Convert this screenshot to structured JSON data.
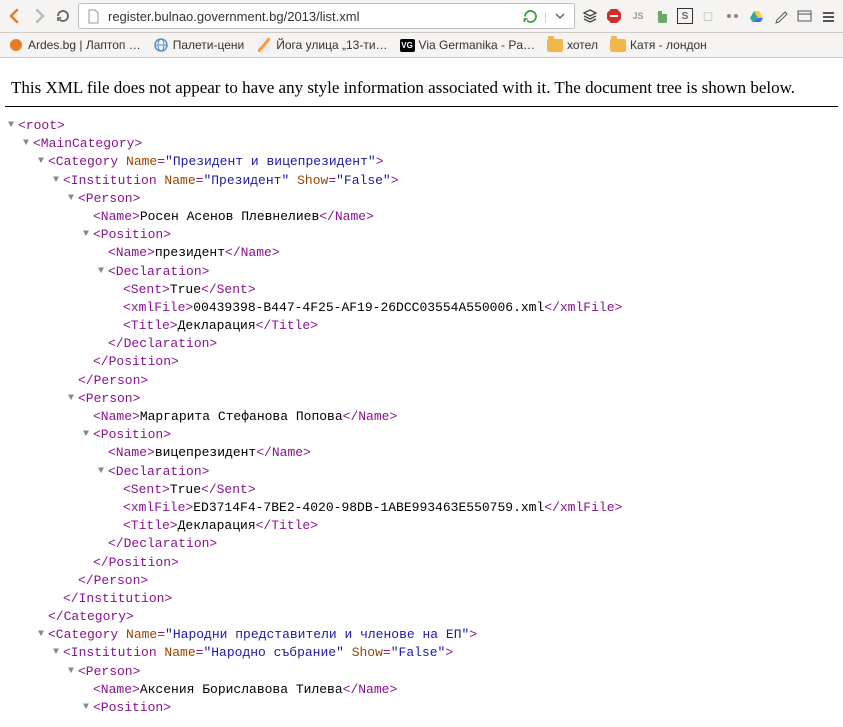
{
  "url": "register.bulnao.government.bg/2013/list.xml",
  "message": "This XML file does not appear to have any style information associated with it. The document tree is shown below.",
  "bookmarks": [
    {
      "label": "Ardes.bg | Лаптоп …",
      "icon": "ardes"
    },
    {
      "label": "Палети-цени",
      "icon": "globe"
    },
    {
      "label": "Йога улица „13-ти…",
      "icon": "gmaps"
    },
    {
      "label": "Via Germanika - Pa…",
      "icon": "vg"
    },
    {
      "label": "хотел",
      "icon": "folder"
    },
    {
      "label": "Катя - лондон",
      "icon": "folder"
    }
  ],
  "s": {
    "root_o": "<root>",
    "maincat_o": "<MainCategory>",
    "cat1_o1": "<Category ",
    "cat1_attr": "Name",
    "cat1_val": "\"Президент и вицепрезидент\"",
    "cat1_o2": ">",
    "inst1_o1": "<Institution ",
    "inst1_a1": "Name",
    "inst1_v1": "\"Президент\"",
    "inst1_a2": "Show",
    "inst1_v2": "\"False\"",
    "inst1_o2": ">",
    "person_o": "<Person>",
    "person_c": "</Person>",
    "name_o": "<Name>",
    "name_c": "</Name>",
    "pos_o": "<Position>",
    "pos_c": "</Position>",
    "decl_o": "<Declaration>",
    "decl_c": "</Declaration>",
    "sent_o": "<Sent>",
    "sent_c": "</Sent>",
    "xf_o": "<xmlFile>",
    "xf_c": "</xmlFile>",
    "title_o": "<Title>",
    "title_c": "</Title>",
    "inst_c": "</Institution>",
    "cat_c": "</Category>",
    "p1_name": "Росен Асенов Плевнелиев",
    "p1_pos": "президент",
    "p1_sent": "True",
    "p1_file": "00439398-B447-4F25-AF19-26DCC03554A550006.xml",
    "p1_title": "Декларация",
    "p2_name": "Маргарита Стефанова Попова",
    "p2_pos": "вицепрезидент",
    "p2_sent": "True",
    "p2_file": "ED3714F4-7BE2-4020-98DB-1ABE993463E550759.xml",
    "p2_title": "Декларация",
    "cat2_o1": "<Category ",
    "cat2_attr": "Name",
    "cat2_val": "\"Народни представители и членове на ЕП\"",
    "cat2_o2": ">",
    "inst2_o1": "<Institution ",
    "inst2_a1": "Name",
    "inst2_v1": "\"Народно събрание\"",
    "inst2_a2": "Show",
    "inst2_v2": "\"False\"",
    "inst2_o2": ">",
    "p3_name": "Аксения Бориславова Тилева"
  }
}
